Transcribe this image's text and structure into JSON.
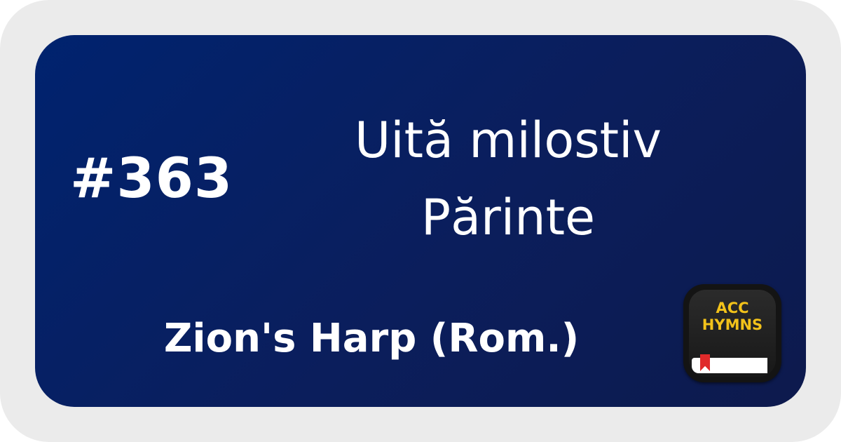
{
  "hymn": {
    "number": "#363",
    "title_line1": "Uită milostiv",
    "title_line2": "Părinte",
    "book": "Zion's Harp (Rom.)"
  },
  "logo": {
    "line1": "ACC",
    "line2": "HYMNS"
  },
  "colors": {
    "frame": "#ebebeb",
    "card_gradient_start": "#00236f",
    "card_gradient_end": "#0d1a4d",
    "text": "#ffffff",
    "logo_text": "#f2c21a",
    "logo_ribbon": "#e02a2a"
  }
}
